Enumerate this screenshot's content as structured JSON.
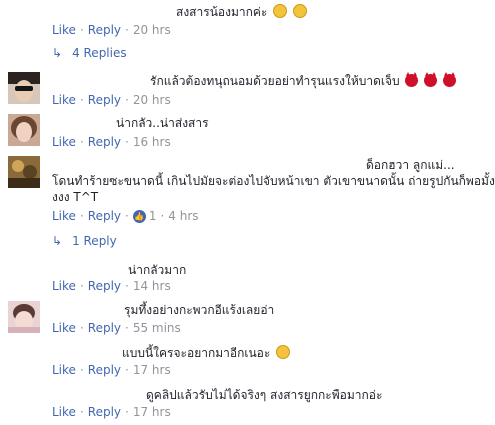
{
  "labels": {
    "like": "Like",
    "reply": "Reply"
  },
  "comments": [
    {
      "text": "สงสารน้องมากค่ะ",
      "time": "20 hrs",
      "replies": "4 Replies"
    },
    {
      "text": "รักแล้วต้องทนุถนอมด้วยอย่าทำรุนแรงให้บาดเจ็บ",
      "time": "20 hrs"
    },
    {
      "text": "น่ากลัว..น่าส่งสาร",
      "time": "16 hrs"
    },
    {
      "text_line1": "ด็อกฮวา ลูกแม่...",
      "text_line2": "โดนทำร้ายซะขนาดนี้ เกินไปมัยจะต่องไปจับหน้าเขา ตัวเขาขนาดนั้น ถ่ายรูปกันก็พอมั้งง",
      "text_line3": "งงง T^T",
      "time": "4 hrs",
      "like_count": "1",
      "replies": "1 Reply"
    },
    {
      "text": "น่ากลัวมาก",
      "time": "14 hrs"
    },
    {
      "text": "รุมทึ้งอย่างกะพวกอีแร้งเลยอ่า",
      "time": "55 mins"
    },
    {
      "text": "แบบนี้ใครจะอยากมาอีกเนอะ",
      "time": "17 hrs"
    },
    {
      "text": "ดูคลิปแล้วรับไม่ได้จริงๆ สงสารยูกกะพือมากอ่ะ",
      "time": "17 hrs"
    }
  ],
  "colors": {
    "link": "#4267b2",
    "meta": "#90949c",
    "text": "#1d2129"
  }
}
